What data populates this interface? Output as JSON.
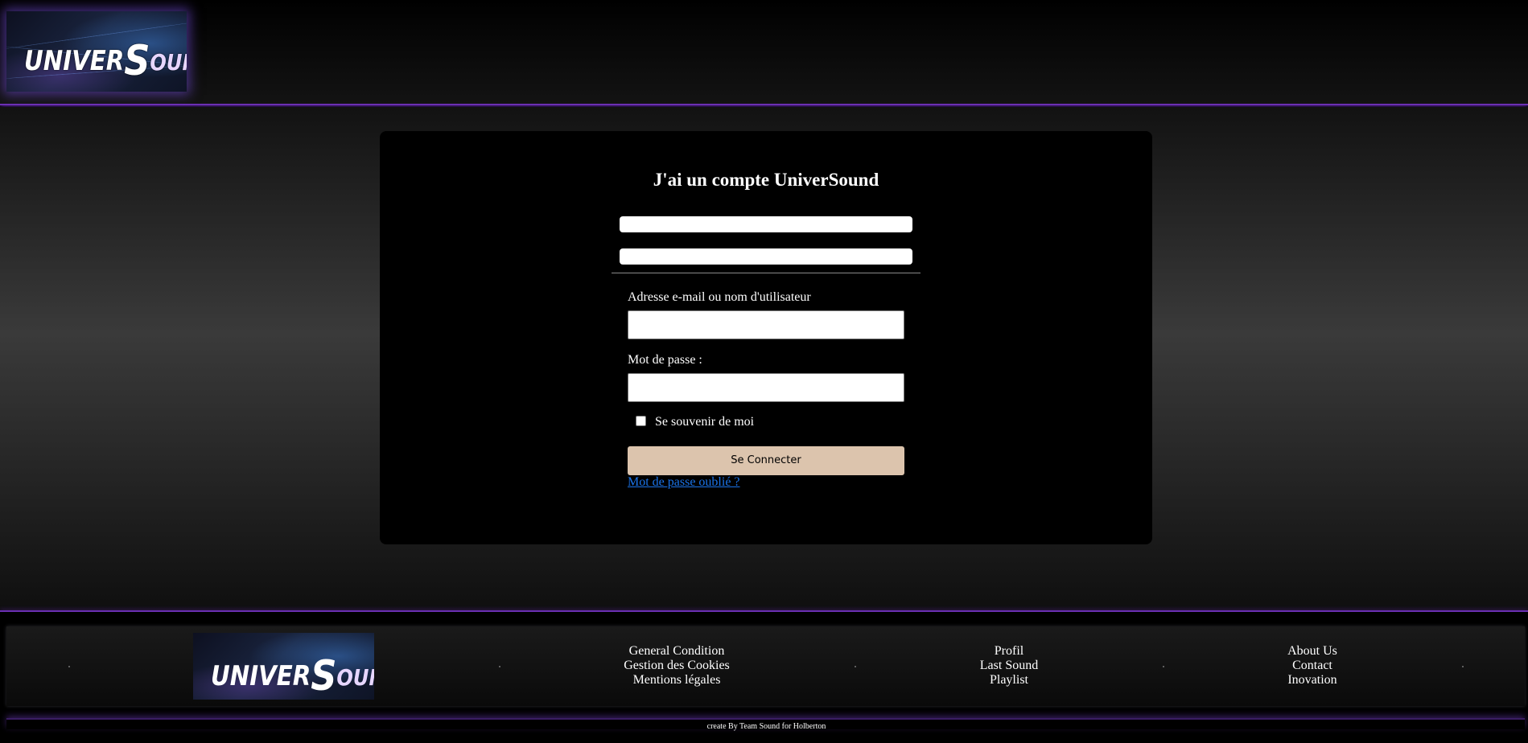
{
  "header": {
    "logo": {
      "prefix": "UNIVER",
      "big_letter": "S",
      "suffix": "OUND",
      "alt": "UniverSound logo"
    }
  },
  "login": {
    "title": "J'ai un compte UniverSound",
    "email_label": "Adresse e-mail ou nom d'utilisateur",
    "email_value": "",
    "password_label": "Mot de passe :",
    "password_value": "",
    "remember_label": "Se souvenir de moi",
    "remember_checked": false,
    "submit_label": "Se Connecter",
    "forgot_label": "Mot de passe oublié ?"
  },
  "footer": {
    "columns": [
      {
        "links": [
          "General Condition",
          "Gestion des Cookies",
          "Mentions légales"
        ]
      },
      {
        "links": [
          "Profil",
          "Last Sound",
          "Playlist"
        ]
      },
      {
        "links": [
          "About Us",
          "Contact",
          "Inovation"
        ]
      }
    ],
    "credit": "create By Team Sound for Holberton"
  },
  "colors": {
    "accent_purple": "#6b2fb3",
    "button_beige": "#dcc4ad",
    "link_blue": "#1a73e8",
    "card_bg": "#000000"
  }
}
